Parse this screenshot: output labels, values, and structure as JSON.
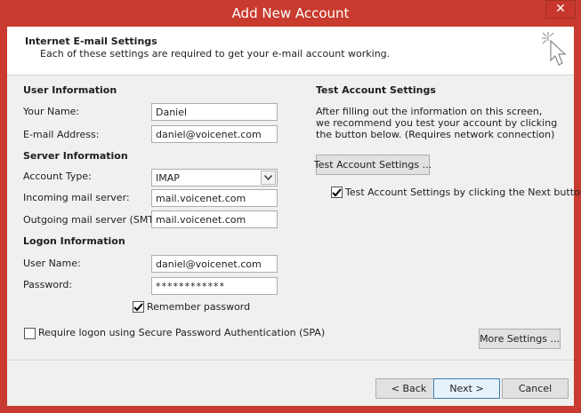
{
  "window": {
    "title": "Add New Account",
    "close_symbol": "✕"
  },
  "header": {
    "title": "Internet E-mail Settings",
    "subtitle": "Each of these settings are required to get your e-mail account working.",
    "icon": "cursor-sparkle-icon"
  },
  "user_info": {
    "heading": "User Information",
    "name_label": "Your Name:",
    "name_value": "Daniel",
    "email_label": "E-mail Address:",
    "email_value": "daniel@voicenet.com"
  },
  "server_info": {
    "heading": "Server Information",
    "account_type_label": "Account Type:",
    "account_type_value": "IMAP",
    "incoming_label": "Incoming mail server:",
    "incoming_value": "mail.voicenet.com",
    "outgoing_label": "Outgoing mail server (SMTP):",
    "outgoing_value": "mail.voicenet.com"
  },
  "logon_info": {
    "heading": "Logon Information",
    "username_label": "User Name:",
    "username_value": "daniel@voicenet.com",
    "password_label": "Password:",
    "password_value": "************",
    "remember_label": "Remember password",
    "remember_checked": true,
    "spa_label": "Require logon using Secure Password Authentication (SPA)",
    "spa_checked": false
  },
  "test_settings": {
    "heading": "Test Account Settings",
    "description": "After filling out the information on this screen, we recommend you test your account by clicking the button below. (Requires network connection)",
    "button_label": "Test Account Settings ...",
    "next_check_label": "Test Account Settings by clicking the Next button",
    "next_check_checked": true
  },
  "more_settings_label": "More Settings ...",
  "footer": {
    "back_label": "< Back",
    "next_label": "Next >",
    "cancel_label": "Cancel"
  },
  "colors": {
    "title_bar": "#c83b2e",
    "dialog_bg": "#f0f0f0",
    "default_button_border": "#3c7fb1"
  }
}
